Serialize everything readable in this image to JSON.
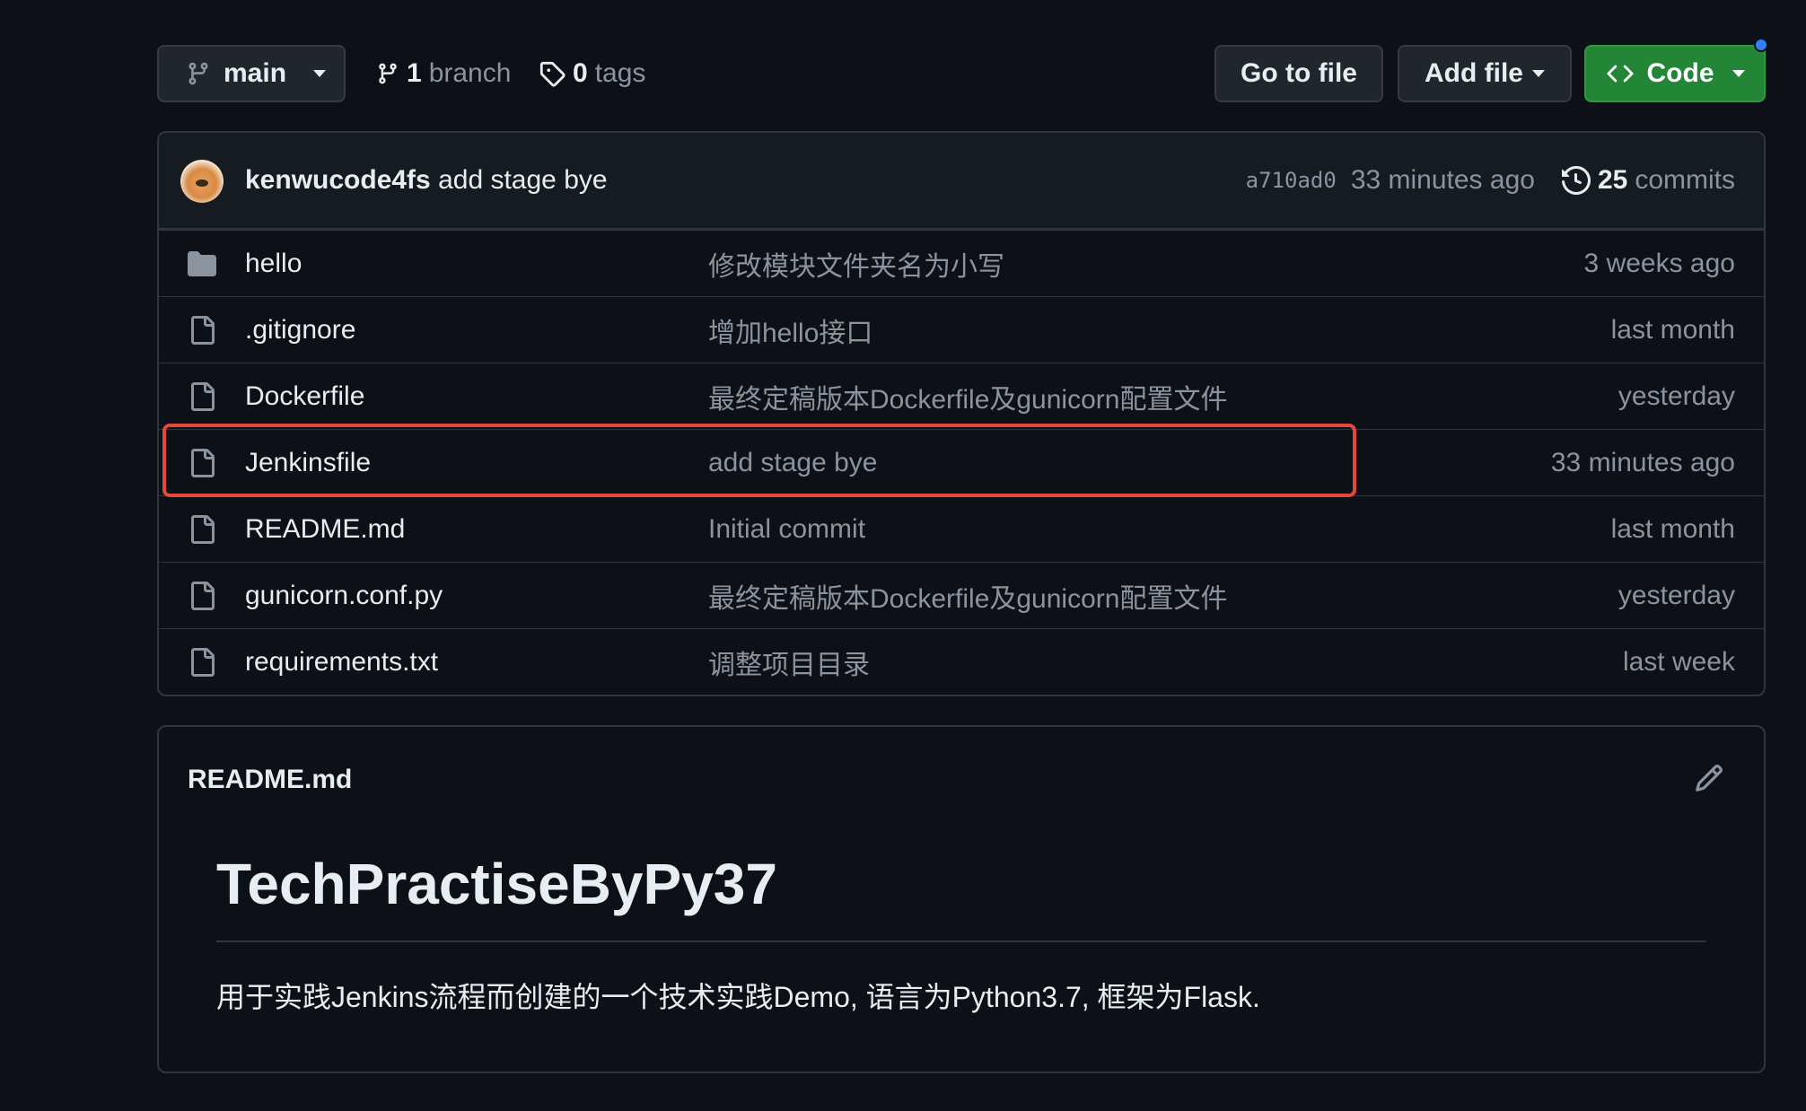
{
  "toolbar": {
    "branch_label": "main",
    "branch_count": "1",
    "branch_word": "branch",
    "tag_count": "0",
    "tag_word": "tags",
    "goto_label": "Go to file",
    "addfile_label": "Add file",
    "code_label": "Code"
  },
  "commit": {
    "author": "kenwucode4fs",
    "message": "add stage bye",
    "sha": "a710ad0",
    "time": "33 minutes ago",
    "commit_count": "25",
    "commit_word": "commits"
  },
  "files": [
    {
      "name": "hello",
      "type": "folder",
      "message": "修改模块文件夹名为小写",
      "date": "3 weeks ago"
    },
    {
      "name": ".gitignore",
      "type": "file",
      "message": "增加hello接口",
      "date": "last month"
    },
    {
      "name": "Dockerfile",
      "type": "file",
      "message": "最终定稿版本Dockerfile及gunicorn配置文件",
      "date": "yesterday"
    },
    {
      "name": "Jenkinsfile",
      "type": "file",
      "message": "add stage bye",
      "date": "33 minutes ago",
      "highlighted": true
    },
    {
      "name": "README.md",
      "type": "file",
      "message": "Initial commit",
      "date": "last month"
    },
    {
      "name": "gunicorn.conf.py",
      "type": "file",
      "message": "最终定稿版本Dockerfile及gunicorn配置文件",
      "date": "yesterday"
    },
    {
      "name": "requirements.txt",
      "type": "file",
      "message": "调整项目目录",
      "date": "last week"
    }
  ],
  "readme": {
    "filename": "README.md",
    "heading": "TechPractiseByPy37",
    "body": "用于实践Jenkins流程而创建的一个技术实践Demo, 语言为Python3.7, 框架为Flask."
  },
  "colors": {
    "background": "#0d1117",
    "code_button": "#238636",
    "highlight_border": "#e5483a",
    "notification_dot": "#2f81f7"
  }
}
